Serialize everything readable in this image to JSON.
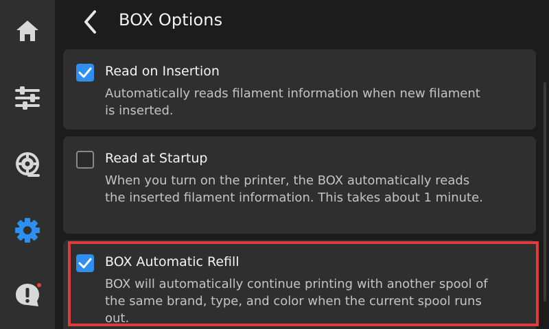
{
  "header": {
    "title": "BOX Options"
  },
  "options": [
    {
      "title": "Read on Insertion",
      "description": "Automatically reads filament information when new filament is inserted.",
      "checked": true
    },
    {
      "title": "Read at Startup",
      "description": "When you turn on the printer, the BOX automatically reads the inserted filament information. This takes about 1 minute.",
      "checked": false
    },
    {
      "title": "BOX Automatic Refill",
      "description": "BOX will automatically continue printing with another spool of the same brand, type, and color when the current spool runs out.",
      "checked": true
    }
  ],
  "sidebar": {
    "items": [
      {
        "icon": "home-icon"
      },
      {
        "icon": "sliders-icon"
      },
      {
        "icon": "filament-spool-icon"
      },
      {
        "icon": "gear-icon",
        "active": true
      },
      {
        "icon": "notification-icon",
        "badge": true
      }
    ]
  },
  "colors": {
    "accent": "#2f8ff0",
    "highlight": "#e03b3d",
    "card": "#2f2f2f",
    "background": "#1c1c1c"
  }
}
